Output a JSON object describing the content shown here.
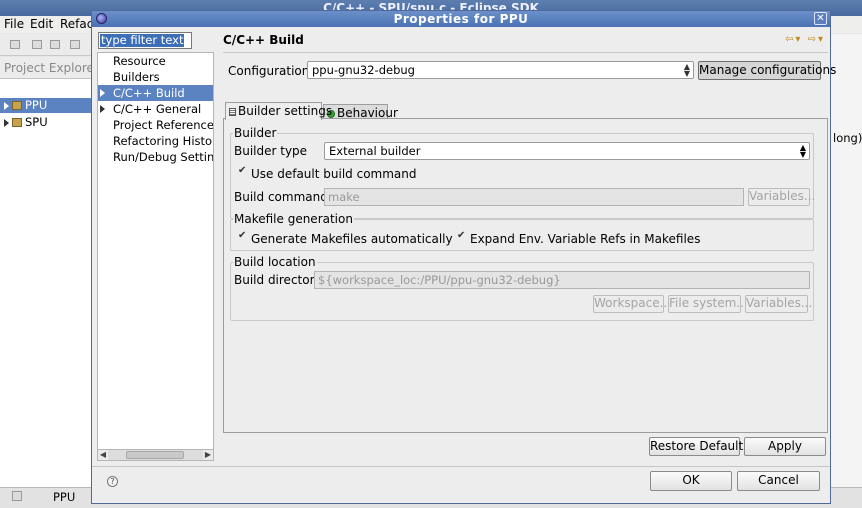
{
  "background_window": {
    "title": "C/C++ - SPU/spu.c - Eclipse SDK",
    "menu": [
      "File",
      "Edit",
      "Refactor"
    ],
    "explorer_title": "Project Explorer",
    "tree": [
      {
        "label": "PPU",
        "selected": true
      },
      {
        "label": "SPU",
        "selected": false
      }
    ],
    "right_text": "long)",
    "status_label": "PPU"
  },
  "dialog": {
    "title": "Properties for PPU",
    "filter": {
      "placeholder": "type filter text"
    },
    "nav_items": [
      {
        "label": "Resource",
        "expandable": false,
        "selected": false
      },
      {
        "label": "Builders",
        "expandable": false,
        "selected": false
      },
      {
        "label": "C/C++ Build",
        "expandable": true,
        "selected": true
      },
      {
        "label": "C/C++ General",
        "expandable": true,
        "selected": false
      },
      {
        "label": "Project References",
        "expandable": false,
        "selected": false
      },
      {
        "label": "Refactoring History",
        "expandable": false,
        "selected": false
      },
      {
        "label": "Run/Debug Settings",
        "expandable": false,
        "selected": false
      }
    ],
    "page_title": "C/C++ Build",
    "configuration": {
      "label": "Configuration:",
      "value": "ppu-gnu32-debug",
      "manage_button": "Manage configurations"
    },
    "tabs": [
      {
        "label": "Builder settings",
        "active": true
      },
      {
        "label": "Behaviour",
        "active": false
      }
    ],
    "builder_group": {
      "title": "Builder",
      "builder_type_label": "Builder type",
      "builder_type_value": "External builder",
      "use_default_label": "Use default build command",
      "use_default_checked": true,
      "build_command_label": "Build command:",
      "build_command_value": "make",
      "variables_button": "Variables..."
    },
    "makefile_group": {
      "title": "Makefile generation",
      "generate_label": "Generate Makefiles automatically",
      "generate_checked": true,
      "expand_label": "Expand Env. Variable Refs in Makefiles",
      "expand_checked": true
    },
    "location_group": {
      "title": "Build location",
      "dir_label": "Build directory",
      "dir_value": "${workspace_loc:/PPU/ppu-gnu32-debug}",
      "workspace_button": "Workspace...",
      "filesystem_button": "File system...",
      "variables_button": "Variables..."
    },
    "buttons": {
      "restore": "Restore Defaults",
      "apply": "Apply",
      "ok": "OK",
      "cancel": "Cancel"
    }
  },
  "colors": {
    "selection": "#5b82c1",
    "title_bar": "#5577b7"
  }
}
